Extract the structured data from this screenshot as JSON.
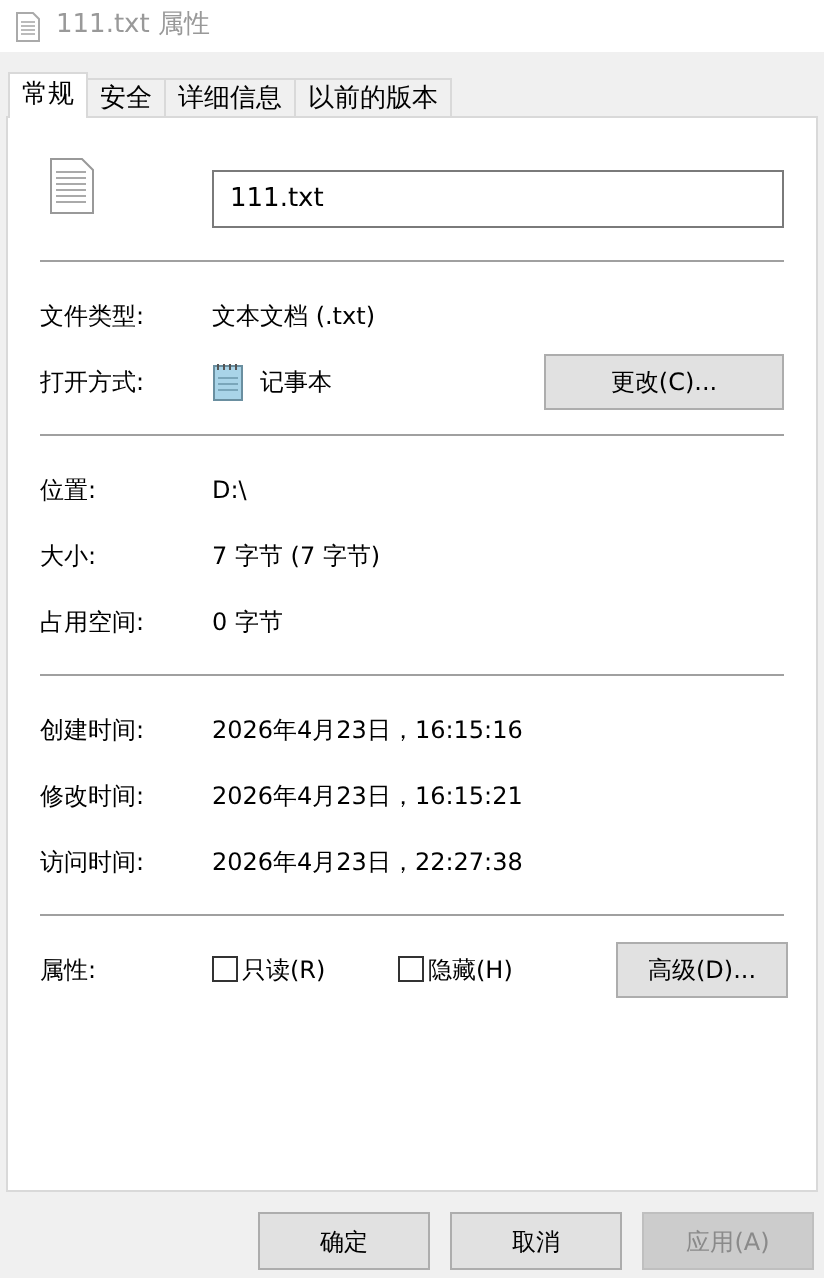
{
  "window": {
    "title": "111.txt 属性"
  },
  "tabs": [
    {
      "label": "常规",
      "selected": true
    },
    {
      "label": "安全",
      "selected": false
    },
    {
      "label": "详细信息",
      "selected": false
    },
    {
      "label": "以前的版本",
      "selected": false
    }
  ],
  "name_field": {
    "value": "111.txt"
  },
  "sections": [
    [
      {
        "kind": "text",
        "label": "文件类型:",
        "value": "文本文档 (.txt)"
      },
      {
        "kind": "app",
        "label": "打开方式:",
        "value": "记事本",
        "button": "更改(C)..."
      }
    ],
    [
      {
        "kind": "text",
        "label": "位置:",
        "value": "D:\\"
      },
      {
        "kind": "text",
        "label": "大小:",
        "value": "7 字节 (7 字节)"
      },
      {
        "kind": "text",
        "label": "占用空间:",
        "value": "0 字节"
      }
    ],
    [
      {
        "kind": "text",
        "label": "创建时间:",
        "value": "2026年4月23日，16:15:16"
      },
      {
        "kind": "text",
        "label": "修改时间:",
        "value": "2026年4月23日，16:15:21"
      },
      {
        "kind": "text",
        "label": "访问时间:",
        "value": "2026年4月23日，22:27:38"
      }
    ],
    [
      {
        "kind": "attrs",
        "label": "属性:",
        "checkboxes": [
          {
            "label": "只读(R)",
            "checked": false
          },
          {
            "label": "隐藏(H)",
            "checked": false
          }
        ],
        "button": "高级(D)..."
      }
    ]
  ],
  "buttons": [
    {
      "label": "确定",
      "disabled": false
    },
    {
      "label": "取消",
      "disabled": false
    },
    {
      "label": "应用(A)",
      "disabled": true
    }
  ]
}
